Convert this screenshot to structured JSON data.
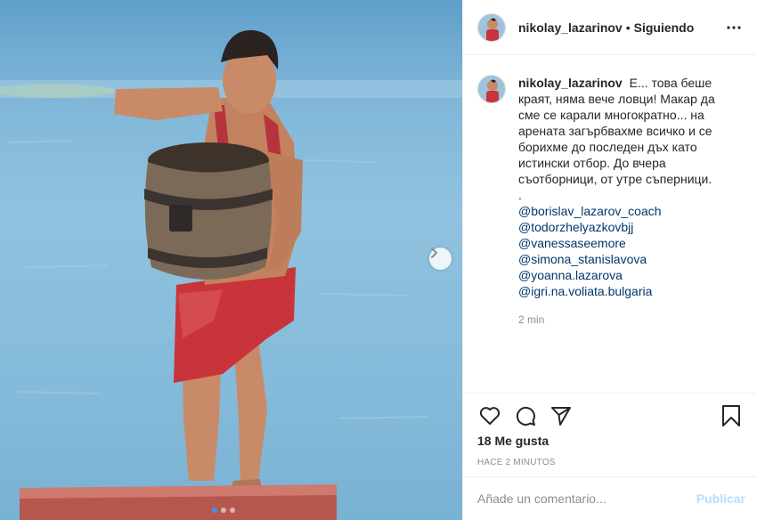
{
  "post": {
    "username": "nikolay_lazarinov",
    "separator": "•",
    "follow_status": "Siguiendo",
    "caption_username": "nikolay_lazarinov",
    "caption_text": "Е... това беше краят, няма вече ловци! Макар да сме се карали многократно... на арената загърбвахме всичко и се борихме до последен дъх като истински отбор. До вчера съотборници, от утре съперници.",
    "caption_dot": ".",
    "mentions": [
      "@borislav_lazarov_coach",
      "@todorzhelyazkovbjj",
      "@vanessaseemore",
      "@simona_stanislavova",
      "@yoanna.lazarova",
      "@igri.na.voliata.bulgaria"
    ],
    "comment_age": "2 min",
    "likes_count": "18",
    "likes_label": "Me gusta",
    "posted_ago": "HACE 2 MINUTOS"
  },
  "comment_box": {
    "placeholder": "Añade un comentario...",
    "publish_label": "Publicar"
  },
  "icons": {
    "more": "more-options-icon",
    "like": "heart-icon",
    "comment": "comment-bubble-icon",
    "share": "paper-plane-icon",
    "save": "bookmark-icon",
    "next": "chevron-right-icon"
  },
  "carousel": {
    "total": 3,
    "active_index": 0
  },
  "colors": {
    "mention": "#00376b",
    "publish_disabled": "#b2dffc",
    "carousel_active": "#3897f0"
  }
}
